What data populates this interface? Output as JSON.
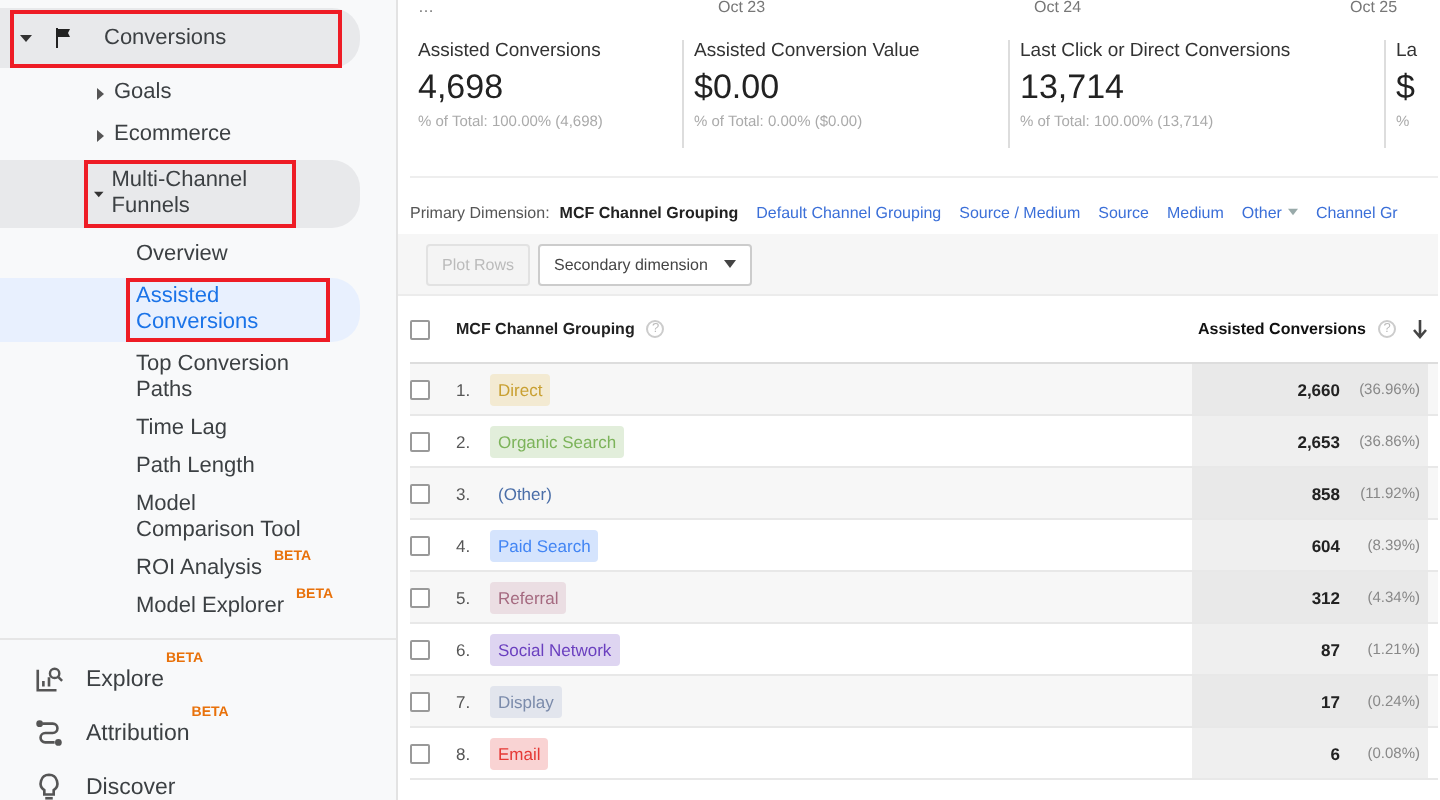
{
  "sidebar": {
    "items": [
      {
        "kind": "flag",
        "label": "Conversions",
        "expanded": true,
        "highlighted": true,
        "selected": false,
        "children": [
          {
            "label": "Goals",
            "expanded": false,
            "highlighted": false,
            "selected": false
          },
          {
            "label": "Ecommerce",
            "expanded": false,
            "highlighted": false,
            "selected": false
          },
          {
            "label": "Multi-Channel Funnels",
            "expanded": true,
            "highlighted": true,
            "selected": false,
            "children": [
              {
                "label": "Overview",
                "highlighted": false,
                "selected": false
              },
              {
                "label": "Assisted Conversions",
                "highlighted": true,
                "selected": true
              },
              {
                "label": "Top Conversion Paths",
                "highlighted": false,
                "selected": false
              },
              {
                "label": "Time Lag",
                "highlighted": false,
                "selected": false
              },
              {
                "label": "Path Length",
                "highlighted": false,
                "selected": false
              },
              {
                "label": "Model Comparison Tool",
                "highlighted": false,
                "selected": false
              },
              {
                "label": "ROI Analysis",
                "badge": "BETA",
                "highlighted": false,
                "selected": false
              },
              {
                "label": "Model Explorer",
                "badge": "BETA",
                "highlighted": false,
                "selected": false
              }
            ]
          }
        ]
      }
    ],
    "nav": [
      {
        "kind": "explore",
        "label": "Explore",
        "badge": "BETA"
      },
      {
        "kind": "attribution",
        "label": "Attribution",
        "badge": "BETA"
      },
      {
        "kind": "discover",
        "label": "Discover"
      }
    ]
  },
  "timeline": {
    "dates": [
      "…",
      "Oct 23",
      "Oct 24",
      "Oct 25"
    ]
  },
  "metrics": [
    {
      "title": "Assisted Conversions",
      "value": "4,698",
      "subtitle": "% of Total: 100.00% (4,698)"
    },
    {
      "title": "Assisted Conversion Value",
      "value": "$0.00",
      "subtitle": "% of Total: 0.00% ($0.00)"
    },
    {
      "title": "Last Click or Direct Conversions",
      "value": "13,714",
      "subtitle": "% of Total: 100.00% (13,714)"
    },
    {
      "title": "La",
      "value": "$",
      "subtitle": "%"
    }
  ],
  "primary_dimension": {
    "label": "Primary Dimension:",
    "options": [
      {
        "label": "MCF Channel Grouping",
        "kind": "link",
        "selected": true
      },
      {
        "label": "Default Channel Grouping",
        "kind": "link",
        "selected": false
      },
      {
        "label": "Source / Medium",
        "kind": "link",
        "selected": false
      },
      {
        "label": "Source",
        "kind": "link",
        "selected": false
      },
      {
        "label": "Medium",
        "kind": "link",
        "selected": false
      },
      {
        "label": "Other",
        "kind": "menu",
        "selected": false
      },
      {
        "label": "Channel Gr",
        "kind": "link",
        "selected": false
      }
    ]
  },
  "toolbar": {
    "plot_rows": {
      "label": "Plot Rows",
      "disabled": true
    },
    "secondary_dimension": "Secondary dimension"
  },
  "table": {
    "header_checked": false,
    "columns": [
      {
        "label": "MCF Channel Grouping",
        "help": "?"
      },
      {
        "label": "Assisted Conversions",
        "help": "?",
        "sorted": true
      }
    ],
    "rows": [
      {
        "index": "1.",
        "channel": "Direct",
        "color": "#c9a032",
        "tagged": true,
        "value": "2,660",
        "share": "(36.96%)",
        "checked": false
      },
      {
        "index": "2.",
        "channel": "Organic Search",
        "color": "#7cb35a",
        "tagged": true,
        "value": "2,653",
        "share": "(36.86%)",
        "checked": false
      },
      {
        "index": "3.",
        "channel": "(Other)",
        "color": "#4a6ea8",
        "tagged": false,
        "value": "858",
        "share": "(11.92%)",
        "checked": false
      },
      {
        "index": "4.",
        "channel": "Paid Search",
        "color": "#4285f4",
        "tagged": true,
        "value": "604",
        "share": "(8.39%)",
        "checked": false
      },
      {
        "index": "5.",
        "channel": "Referral",
        "color": "#a56a80",
        "tagged": true,
        "value": "312",
        "share": "(4.34%)",
        "checked": false
      },
      {
        "index": "6.",
        "channel": "Social Network",
        "color": "#6a3fbf",
        "tagged": true,
        "value": "87",
        "share": "(1.21%)",
        "checked": false
      },
      {
        "index": "7.",
        "channel": "Display",
        "color": "#7b8bab",
        "tagged": true,
        "value": "17",
        "share": "(0.24%)",
        "checked": false
      },
      {
        "index": "8.",
        "channel": "Email",
        "color": "#e53935",
        "tagged": true,
        "value": "6",
        "share": "(0.08%)",
        "checked": false
      }
    ]
  }
}
